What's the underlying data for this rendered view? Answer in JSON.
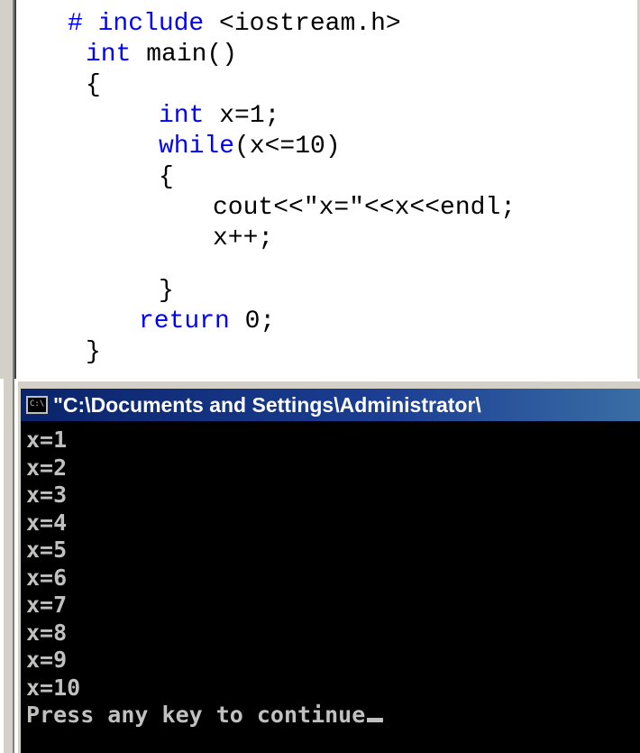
{
  "editor": {
    "lines": [
      {
        "parts": [
          {
            "t": "# include",
            "kw": true
          },
          {
            "t": " <iostream.h>",
            "kw": false
          }
        ]
      },
      {
        "parts": [
          {
            "t": "int",
            "kw": true
          },
          {
            "t": " main()",
            "kw": false
          }
        ]
      },
      {
        "parts": [
          {
            "t": "{",
            "kw": false
          }
        ]
      },
      {
        "parts": [
          {
            "t": "int",
            "kw": true
          },
          {
            "t": " x=1;",
            "kw": false
          }
        ]
      },
      {
        "parts": [
          {
            "t": "while",
            "kw": true
          },
          {
            "t": "(x<=10)",
            "kw": false
          }
        ]
      },
      {
        "parts": [
          {
            "t": "{",
            "kw": false
          }
        ]
      },
      {
        "parts": [
          {
            "t": "cout<<\"x=\"<<x<<endl;",
            "kw": false
          }
        ]
      },
      {
        "parts": [
          {
            "t": "x++;",
            "kw": false
          }
        ]
      },
      {
        "parts": [
          {
            "t": "",
            "kw": false
          }
        ]
      },
      {
        "parts": [
          {
            "t": "}",
            "kw": false
          }
        ]
      },
      {
        "parts": [
          {
            "t": "return",
            "kw": true
          },
          {
            "t": " 0;",
            "kw": false
          }
        ]
      },
      {
        "parts": [
          {
            "t": "}",
            "kw": false
          }
        ]
      }
    ]
  },
  "console": {
    "title": "\"C:\\Documents and Settings\\Administrator\\",
    "icon_text": "C:\\",
    "output": [
      "x=1",
      "x=2",
      "x=3",
      "x=4",
      "x=5",
      "x=6",
      "x=7",
      "x=8",
      "x=9",
      "x=10"
    ],
    "prompt": "Press any key to continue"
  },
  "colors": {
    "keyword": "#0000ff",
    "titlebar": "#0a246a",
    "console_text": "#c0c0c0"
  },
  "icons": {
    "console_icon": "console-window-icon"
  }
}
